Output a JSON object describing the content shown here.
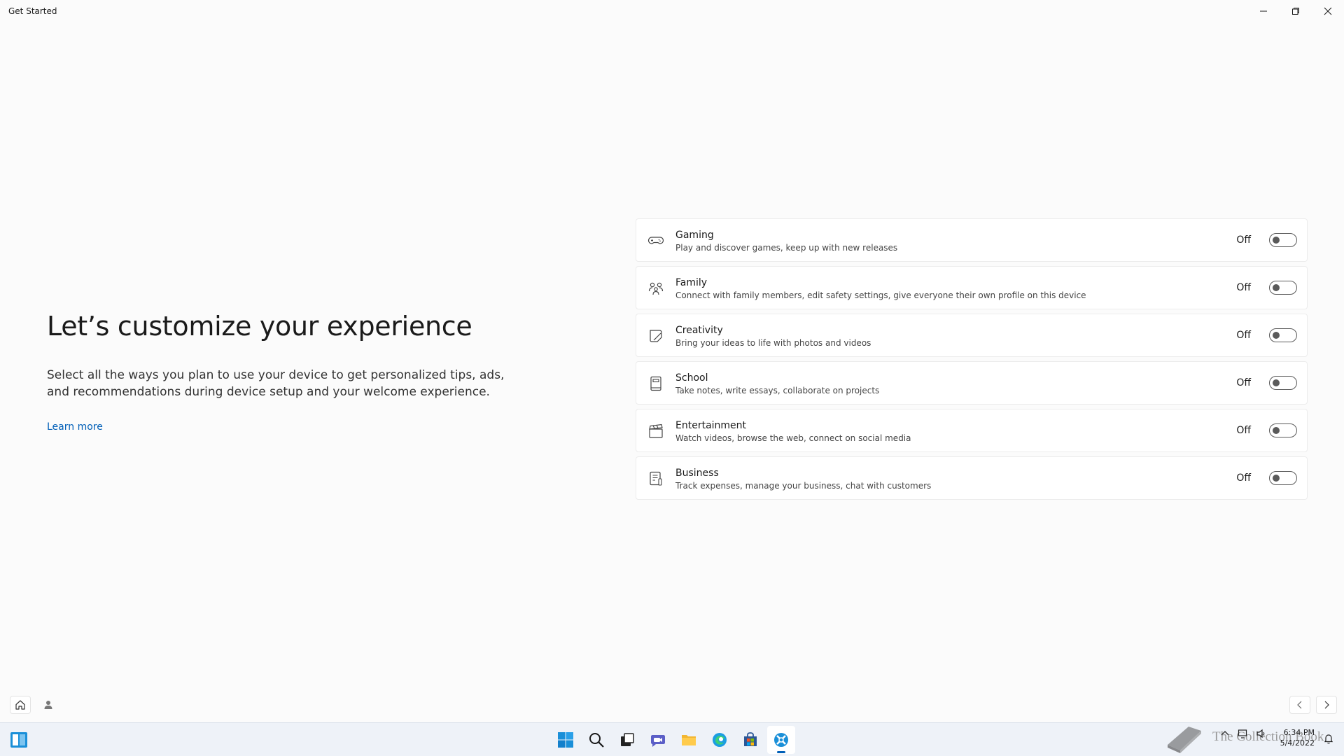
{
  "window": {
    "title": "Get Started"
  },
  "main": {
    "heading": "Let’s customize your experience",
    "description": "Select all the ways you plan to use your device to get personalized tips, ads, and recommendations during device setup and your welcome experience.",
    "learn_more": "Learn more"
  },
  "options": [
    {
      "name": "Gaming",
      "description": "Play and discover games, keep up with new releases",
      "state": "Off",
      "icon": "gamepad-icon"
    },
    {
      "name": "Family",
      "description": "Connect with family members, edit safety settings, give everyone their own profile on this device",
      "state": "Off",
      "icon": "family-icon"
    },
    {
      "name": "Creativity",
      "description": "Bring your ideas to life with photos and videos",
      "state": "Off",
      "icon": "pen-icon"
    },
    {
      "name": "School",
      "description": "Take notes, write essays, collaborate on projects",
      "state": "Off",
      "icon": "notebook-icon"
    },
    {
      "name": "Entertainment",
      "description": "Watch videos, browse the web, connect on social media",
      "state": "Off",
      "icon": "clapperboard-icon"
    },
    {
      "name": "Business",
      "description": "Track expenses, manage your business, chat with customers",
      "state": "Off",
      "icon": "document-icon"
    }
  ],
  "taskbar": {
    "time": "6:34 PM",
    "date": "5/4/2022",
    "watermark": "The Collection Book",
    "accent": "#005fb8"
  }
}
